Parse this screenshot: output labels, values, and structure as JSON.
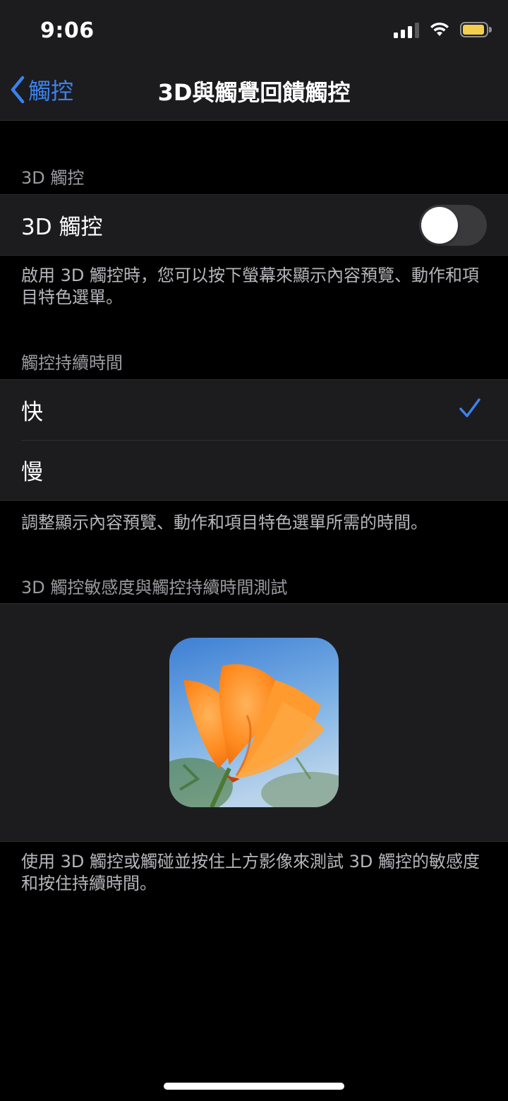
{
  "status_bar": {
    "time": "9:06",
    "signal_icon": "cellular-signal-icon",
    "wifi_icon": "wifi-icon",
    "battery_icon": "battery-icon",
    "battery_color": "#f3cf4d"
  },
  "nav": {
    "back_label": "觸控",
    "title": "3D與觸覺回饋觸控",
    "accent": "#3b82f0"
  },
  "section_3d": {
    "header": "3D 觸控",
    "toggle_label": "3D 觸控",
    "toggle_state": "off",
    "footer": "啟用 3D 觸控時，您可以按下螢幕來顯示內容預覽、動作和項目特色選單。"
  },
  "section_duration": {
    "header": "觸控持續時間",
    "options": [
      {
        "label": "快",
        "selected": true
      },
      {
        "label": "慢",
        "selected": false
      }
    ],
    "footer": "調整顯示內容預覽、動作和項目特色選單所需的時間。"
  },
  "section_test": {
    "header": "3D 觸控敏感度與觸控持續時間測試",
    "image": "orange-poppy-flower-photo",
    "footer": "使用 3D 觸控或觸碰並按住上方影像來測試 3D 觸控的敏感度和按住持續時間。"
  }
}
